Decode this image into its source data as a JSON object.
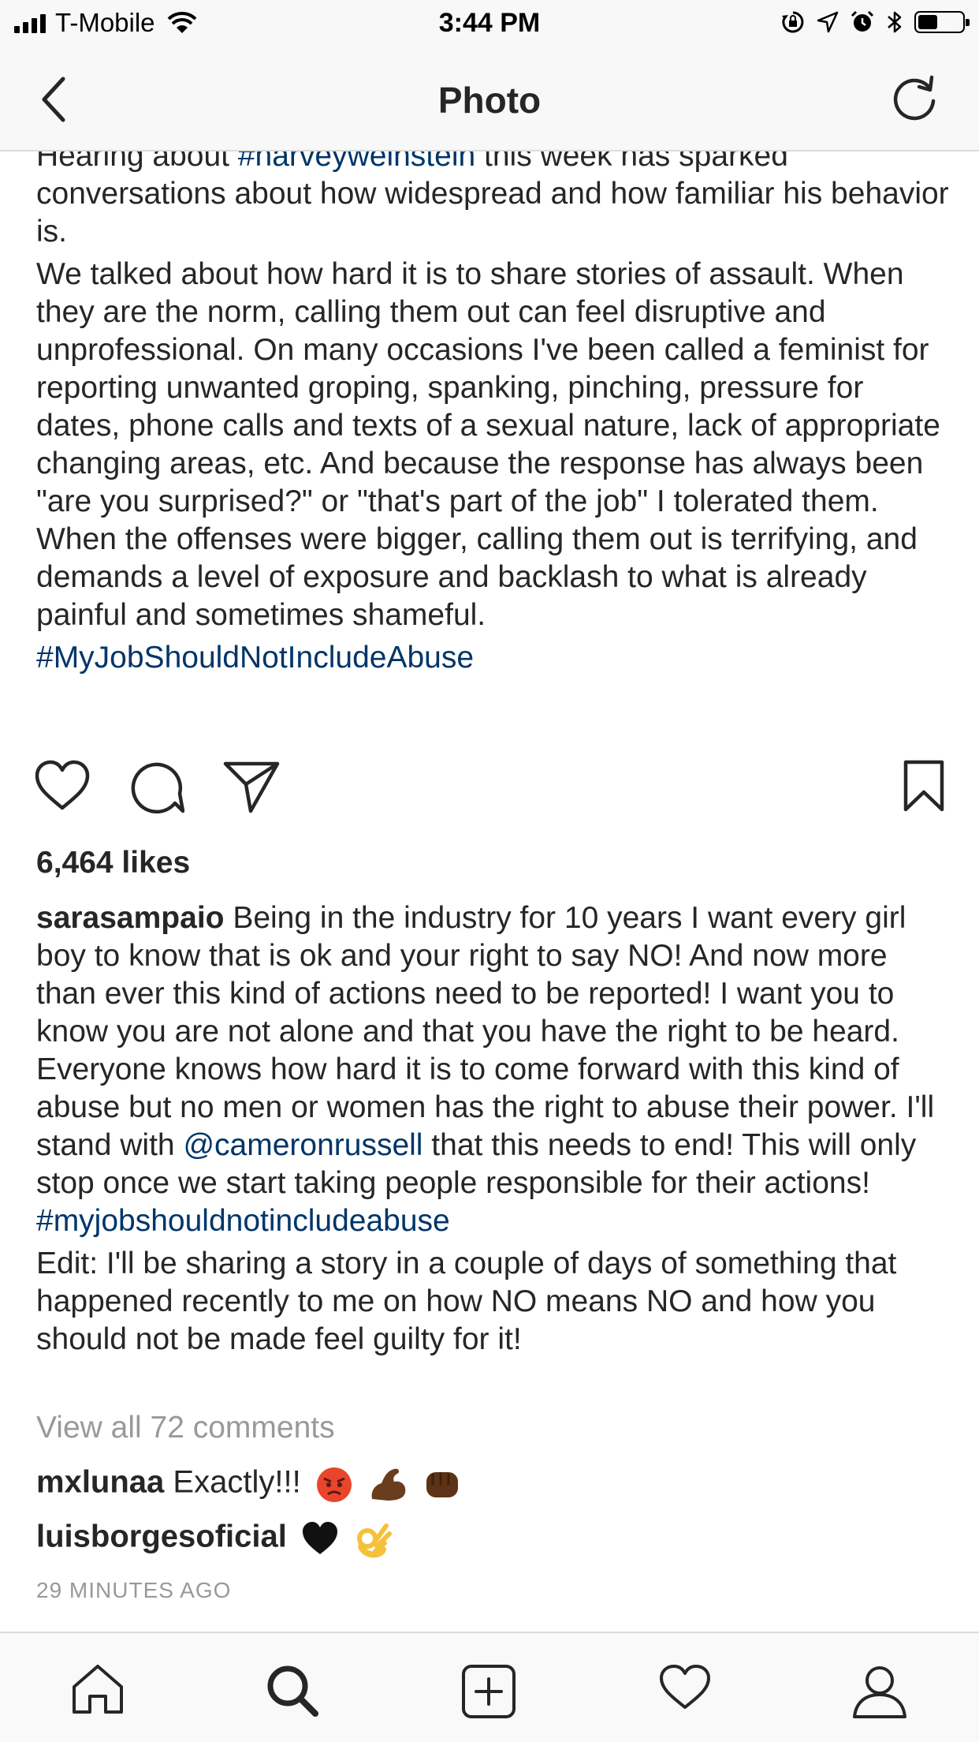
{
  "status_bar": {
    "carrier": "T-Mobile",
    "time": "3:44 PM",
    "battery_level": 0.45,
    "icons": [
      "signal-icon",
      "wifi-icon",
      "orientation-lock-icon",
      "location-icon",
      "alarm-icon",
      "bluetooth-icon",
      "battery-icon"
    ]
  },
  "navbar": {
    "title": "Photo",
    "back_icon": "chevron-left-icon",
    "refresh_icon": "refresh-icon"
  },
  "top_caption": {
    "p1_before": "Hearing about ",
    "p1_tag": "#harveyweinstein",
    "p1_after": " this week has sparked conversations about how widespread and how familiar his behavior is.",
    "p2": "We talked about how hard it is to share stories of assault. When they are the norm, calling them out can feel disruptive and unprofessional. On many occasions I've been called a feminist for reporting unwanted groping, spanking, pinching, pressure for dates, phone calls and texts of a sexual nature, lack of appropriate changing areas, etc. And because the response has always been \"are you surprised?\" or \"that's part of the job\" I tolerated them. When the offenses were bigger, calling them out is terrifying, and demands a level of exposure and backlash to what is already painful and sometimes shameful.",
    "tag_line": "#MyJobShouldNotIncludeAbuse"
  },
  "actions": {
    "like_icon": "heart-icon",
    "comment_icon": "comment-icon",
    "share_icon": "paper-plane-icon",
    "save_icon": "bookmark-icon"
  },
  "likes": "6,464 likes",
  "post": {
    "username": "sarasampaio",
    "text_before": " Being in the industry for 10 years I want every girl boy to know that is ok and your right to say NO! And now more than ever this kind of actions need to be reported! I want you to know you are not alone and that you have the right to be heard. Everyone knows how hard it is to come forward with this kind of abuse but no men or women has the right to abuse their power. I'll stand with ",
    "mention": "@cameronrussell",
    "text_after": " that this needs to end! This will only stop once we start taking people responsible for their actions!",
    "hashtag": "#myjobshouldnotincludeabuse",
    "edit": "Edit: I'll be sharing a story in a couple of days of something that happened recently to me on how NO means NO and how you should not be made feel guilty for it!"
  },
  "view_all": "View all 72 comments",
  "comments": [
    {
      "user": "mxlunaa",
      "text": " Exactly!!!",
      "emoji": [
        "angry-face-emoji",
        "flexed-biceps-emoji",
        "oncoming-fist-emoji"
      ]
    },
    {
      "user": "luisborgesoficial",
      "text": "",
      "emoji": [
        "black-heart-emoji",
        "ok-hand-emoji"
      ]
    }
  ],
  "timestamp": "29 MINUTES AGO",
  "tabbar": {
    "tabs": [
      "home-icon",
      "search-icon",
      "add-post-icon",
      "activity-heart-icon",
      "profile-icon"
    ],
    "active": "search-icon"
  },
  "colors": {
    "link": "#003569",
    "text": "#262626",
    "muted": "#999999",
    "bar_bg": "#f8f8f8"
  }
}
